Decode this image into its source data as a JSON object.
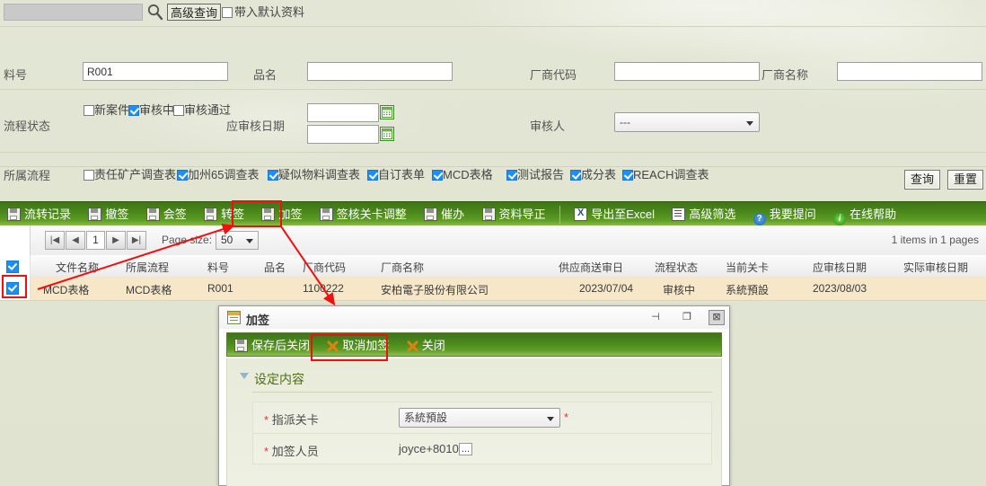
{
  "topbar": {
    "keyword_value": "",
    "keyword_placeholder": "",
    "search_icon": "search-icon",
    "advanced_query_label": "高级查询",
    "default_data_label": "带入默认资料",
    "default_data_checked": false
  },
  "filters": {
    "material_no_label": "料号",
    "material_no_value": "R001",
    "product_name_label": "品名",
    "product_name_value": "",
    "vendor_code_label": "厂商代码",
    "vendor_code_value": "",
    "vendor_name_label": "厂商名称",
    "vendor_name_value": "",
    "flow_status_label": "流程状态",
    "flow_status_options": [
      {
        "label": "新案件",
        "checked": false
      },
      {
        "label": "审核中",
        "checked": true
      },
      {
        "label": "审核通过",
        "checked": false
      }
    ],
    "audit_date_label": "应审核日期",
    "audit_date_from": "",
    "audit_date_to": "",
    "calendar_icon": "calendar-icon",
    "auditor_label": "审核人",
    "auditor_value": "---",
    "belong_flow_label": "所属流程",
    "belong_flow_options": [
      {
        "label": "责任矿产调查表",
        "checked": false
      },
      {
        "label": "加州65调查表",
        "checked": true
      },
      {
        "label": "疑似物料调查表",
        "checked": true
      },
      {
        "label": "自订表单",
        "checked": true
      },
      {
        "label": "MCD表格",
        "checked": true
      },
      {
        "label": "测试报告",
        "checked": true
      },
      {
        "label": "成分表",
        "checked": true
      },
      {
        "label": "REACH调查表",
        "checked": true
      }
    ],
    "query_button": "查询",
    "reset_button": "重置"
  },
  "toolbar": {
    "items": [
      {
        "label": "流转记录",
        "icon": "floppy-icon"
      },
      {
        "label": "撤签",
        "icon": "floppy-icon"
      },
      {
        "label": "会签",
        "icon": "floppy-icon"
      },
      {
        "label": "转签",
        "icon": "floppy-icon"
      },
      {
        "label": "加签",
        "icon": "floppy-icon"
      },
      {
        "label": "签核关卡调整",
        "icon": "floppy-icon"
      },
      {
        "label": "催办",
        "icon": "floppy-icon"
      },
      {
        "label": "资料导正",
        "icon": "floppy-icon"
      }
    ],
    "items_right": [
      {
        "label": "导出至Excel",
        "icon": "excel-icon"
      },
      {
        "label": "高级筛选",
        "icon": "filter-icon"
      },
      {
        "label": "我要提问",
        "icon": "question-icon"
      },
      {
        "label": "在线帮助",
        "icon": "info-icon"
      }
    ]
  },
  "pager": {
    "first_label": "|◀",
    "prev_label": "◀",
    "page_number": "1",
    "next_label": "▶",
    "last_label": "▶|",
    "page_size_label": "Page size:",
    "page_size_value": "50",
    "items_info": "1 items in 1 pages"
  },
  "grid": {
    "header_checked": true,
    "columns": [
      "文件名称",
      "所属流程",
      "料号",
      "品名",
      "厂商代码",
      "厂商名称",
      "供应商送审日",
      "流程状态",
      "当前关卡",
      "应审核日期",
      "实际审核日期"
    ],
    "rows": [
      {
        "checked": true,
        "cells": [
          "MCD表格",
          "MCD表格",
          "R001",
          "",
          "1100222",
          "安柏電子股份有限公司",
          "2023/07/04",
          "审核中",
          "系統預設",
          "2023/08/03",
          ""
        ]
      }
    ]
  },
  "dialog": {
    "title": "加签",
    "title_icon": "form-icon",
    "window_buttons": [
      {
        "name": "pin-button",
        "glyph": "⊣"
      },
      {
        "name": "maximize-button",
        "glyph": "❐"
      },
      {
        "name": "close-button",
        "glyph": "⊠"
      }
    ],
    "toolbar": [
      {
        "label": "保存后关闭",
        "icon": "floppy-icon"
      },
      {
        "label": "取消加签",
        "icon": "cancel-icon"
      },
      {
        "label": "关闭",
        "icon": "cancel-icon"
      }
    ],
    "section_title": "设定内容",
    "fields": [
      {
        "required": "*",
        "label": "指派关卡",
        "value": "系統預設",
        "type": "select",
        "trailing_required": "*"
      },
      {
        "required": "*",
        "label": "加签人员",
        "value": "joyce+8010",
        "type": "picker",
        "picker_label": "..."
      }
    ]
  },
  "annotations": {
    "highlight_color": "#f10f0f",
    "highlights": [
      "toolbar-add-sign-button",
      "row-select-checkbox",
      "dialog-cancel-add-sign-button"
    ]
  }
}
